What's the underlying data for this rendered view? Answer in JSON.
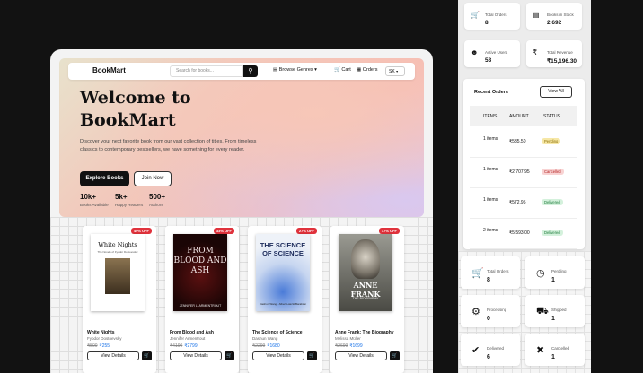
{
  "navbar": {
    "brand": "BookMart",
    "search_placeholder": "Search for books...",
    "browse": "Browse Genres",
    "cart": "Cart",
    "orders": "Orders",
    "user_initials": "SK"
  },
  "hero": {
    "title_line1": "Welcome to",
    "title_line2": "BookMart",
    "description": "Discover your next favorite book from our vast collection of titles. From timeless classics to contemporary bestsellers, we have something for every reader.",
    "explore_button": "Explore Books",
    "join_button": "Join Now",
    "stats": [
      {
        "value": "10k+",
        "label": "Books Available"
      },
      {
        "value": "5k+",
        "label": "Happy Readers"
      },
      {
        "value": "500+",
        "label": "Authors"
      }
    ]
  },
  "books": [
    {
      "badge": "49% OFF",
      "title": "White Nights",
      "author": "Fyodor Dostoevsky",
      "old_price": "₹500",
      "price": "₹255",
      "view": "View Details",
      "cover_title": "White Nights",
      "cover_sub": "The Novels of Fyodor Dostoevsky"
    },
    {
      "badge": "33% OFF",
      "title": "From Blood and Ash",
      "author": "Jennifer Armentrout",
      "old_price": "₹4190",
      "price": "₹2799",
      "view": "View Details",
      "cover_title": "FROM BLOOD AND ASH",
      "cover_sub": "JENNIFER L. ARMENTROUT"
    },
    {
      "badge": "27% OFF",
      "title": "The Science of Science",
      "author": "Dashun Wang",
      "old_price": "₹2299",
      "price": "₹1680",
      "view": "View Details",
      "cover_title": "THE SCIENCE OF SCIENCE",
      "cover_sub": "Dashun Wang · Albert-László Barabási"
    },
    {
      "badge": "17% OFF",
      "title": "Anne Frank: The Biography",
      "author": "Melissa Müller",
      "old_price": "₹2699",
      "price": "₹1699",
      "view": "View Details",
      "cover_title": "ANNE FRANK",
      "cover_sub": "THE BIOGRAPHY"
    }
  ],
  "dashboard": {
    "top_stats": [
      {
        "label": "Total Orders",
        "value": "8",
        "icon": "cart-icon"
      },
      {
        "label": "Books in Stock",
        "value": "2,692",
        "icon": "book-icon"
      },
      {
        "label": "Active Users",
        "value": "53",
        "icon": "users-icon"
      },
      {
        "label": "Total Revenue",
        "value": "₹15,196.30",
        "icon": "rupee-icon"
      }
    ],
    "recent_orders": {
      "title": "Recent Orders",
      "view_all": "View All",
      "columns": [
        "ITEMS",
        "AMOUNT",
        "STATUS"
      ],
      "rows": [
        {
          "items": "1 items",
          "amount": "₹535.50",
          "status": "Pending"
        },
        {
          "items": "1 items",
          "amount": "₹2,707.95",
          "status": "Cancelled"
        },
        {
          "items": "1 items",
          "amount": "₹572.95",
          "status": "Delivered"
        },
        {
          "items": "2 items",
          "amount": "₹5,593.00",
          "status": "Delivered"
        }
      ]
    },
    "order_stats": [
      {
        "label": "Total Orders",
        "value": "8",
        "icon": "cart-icon"
      },
      {
        "label": "Pending",
        "value": "1",
        "icon": "clock-icon"
      },
      {
        "label": "Processing",
        "value": "0",
        "icon": "gear-icon"
      },
      {
        "label": "Shipped",
        "value": "1",
        "icon": "truck-icon"
      },
      {
        "label": "Delivered",
        "value": "6",
        "icon": "check-icon"
      },
      {
        "label": "Cancelled",
        "value": "1",
        "icon": "cancel-icon"
      }
    ]
  },
  "colors": {
    "accent": "#1a73e8",
    "badge": "#e0323c",
    "pending": "#f6e7a6",
    "cancelled": "#f8d3d3",
    "delivered": "#d4f1dc"
  }
}
